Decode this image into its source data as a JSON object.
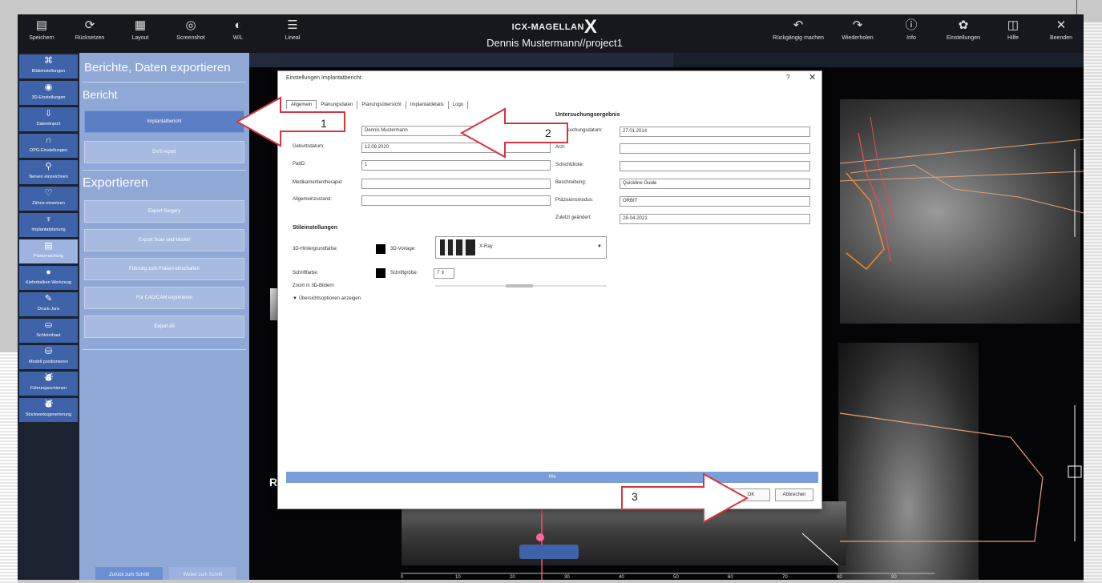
{
  "app": {
    "brand": "ICX-MAGELLAN",
    "brand_x": "X",
    "project": "Dennis Mustermann//project1"
  },
  "toolbar": {
    "left": [
      {
        "icon": "save-icon",
        "glyph": "▤",
        "label": "Speichern"
      },
      {
        "icon": "reset-icon",
        "glyph": "⟳",
        "label": "Rücksetzen"
      },
      {
        "icon": "layout-icon",
        "glyph": "▦",
        "label": "Layout"
      },
      {
        "icon": "camera-icon",
        "glyph": "◎",
        "label": "Screenshot"
      },
      {
        "icon": "contrast-icon",
        "glyph": "◐",
        "label": "W/L"
      },
      {
        "icon": "ruler-icon",
        "glyph": "☰",
        "label": "Lineal"
      }
    ],
    "right": [
      {
        "icon": "undo-icon",
        "glyph": "↶",
        "label": "Rückgängig machen"
      },
      {
        "icon": "redo-icon",
        "glyph": "↷",
        "label": "Wiederholen"
      },
      {
        "icon": "info-icon",
        "glyph": "ⓘ",
        "label": "Info"
      },
      {
        "icon": "settings-icon",
        "glyph": "✿",
        "label": "Einstellungen"
      },
      {
        "icon": "help-icon",
        "glyph": "◫",
        "label": "Hilfe"
      },
      {
        "icon": "close-icon",
        "glyph": "✕",
        "label": "Beenden"
      }
    ]
  },
  "sidebar": {
    "items": [
      {
        "glyph": "⌘",
        "label": "Bildeinstellungen"
      },
      {
        "glyph": "◉",
        "label": "3D-Einstellungen"
      },
      {
        "glyph": "⇩",
        "label": "Datenimport"
      },
      {
        "glyph": "∩",
        "label": "OPG-Einstellungen"
      },
      {
        "glyph": "⚲",
        "label": "Nerven einzeichnen"
      },
      {
        "glyph": "♡",
        "label": "Zähne einsetzen"
      },
      {
        "glyph": "♆",
        "label": "Implantatplanung"
      },
      {
        "glyph": "▤",
        "label": "Planerreichung"
      },
      {
        "glyph": "●",
        "label": "Kieferbalken Werkzeug"
      },
      {
        "glyph": "✎",
        "label": "Druck-Jura"
      },
      {
        "glyph": "⛀",
        "label": "Schleimhaut"
      },
      {
        "glyph": "⛁",
        "label": "Modell positionieren"
      },
      {
        "glyph": "⛇",
        "label": "Führungsschienen"
      },
      {
        "glyph": "⛇",
        "label": "Stockwerksgenerierung"
      }
    ]
  },
  "panel": {
    "title": "Berichte, Daten exportieren",
    "report_heading": "Bericht",
    "report_buttons": [
      "Implantatbericht",
      "DVS report"
    ],
    "export_heading": "Exportieren",
    "export_buttons": [
      "Export Surgery",
      "Export Scan und Modell",
      "Führung zum Fräsen einschalten",
      "Für CAD/CAM exportieren",
      "Export All"
    ],
    "bottom_buttons": [
      "Zurück zum Schritt",
      "Weiter zum Schritt"
    ]
  },
  "dialog": {
    "title": "Einstellungen Implantatbericht",
    "help": "?",
    "close": "✕",
    "tabs": [
      "Allgemein",
      "Planungsdaten",
      "Planungsübersicht",
      "Implantatdetails",
      "Logo"
    ],
    "patient": {
      "name_value": "Dennis Mustermann",
      "birth_label": "Geburtsdatum:",
      "birth_value": "12.09.2020",
      "id_label": "PatID:",
      "id_value": "1",
      "med_label": "Medikamententherapie:",
      "med_value": "",
      "general_label": "Allgemeinzustand:",
      "general_value": ""
    },
    "exam": {
      "heading": "Untersuchungsergebnis",
      "date_label": "Untersuchungsdatum:",
      "date_value": "27.01.2014",
      "doctor_label": "Arzt:",
      "doctor_value": "",
      "slice_label": "Schichtdicke:",
      "slice_value": "",
      "desc_label": "Beschreibung:",
      "desc_value": "Quickline Guide",
      "device_label": "Präzisionsmodus:",
      "device_value": "ORBIT",
      "modified_label": "Zuletzt geändert:",
      "modified_value": "28-04-2021"
    },
    "style": {
      "heading": "Stileinstellungen",
      "bg3d_label": "3D-Hintergrundfarbe:",
      "template_label": "3D-Vorlage:",
      "template_value": "X-Ray",
      "font_color_label": "Schriftfarbe:",
      "font_size_label": "Schriftgröße:",
      "font_size_value": "7",
      "zoom_label": "Zoom in 3D-Bildern",
      "advanced_label": "Übersichtsoptionen anzeigen"
    },
    "progress_text": "0%",
    "ok": "OK",
    "cancel": "Abbrechen"
  },
  "annotations": {
    "arrow1": "1",
    "arrow2": "2",
    "arrow3": "3",
    "arrow_stroke": "#d9343d"
  },
  "image_ui": {
    "r_marker": "R",
    "ruler_ticks": [
      "0",
      "10",
      "20",
      "30",
      "40",
      "50",
      "60",
      "70",
      "80",
      "90",
      "100"
    ]
  }
}
